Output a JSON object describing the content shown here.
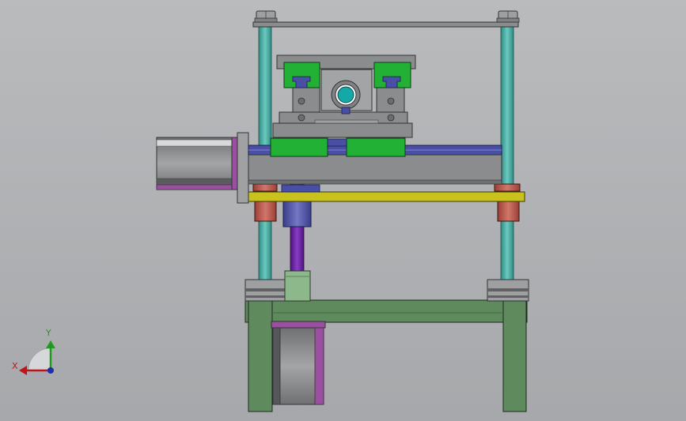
{
  "viewport": {
    "background": "#afb1b4",
    "model": "cad-linear-stage-assembly"
  },
  "triad": {
    "x_label": "X",
    "y_label": "Y",
    "x_color": "#c0141a",
    "y_color": "#1e9b1e",
    "z_color": "#1f2fa8"
  },
  "colors": {
    "frame_green": "#5e8a5d",
    "rail_green": "#22b134",
    "rod_teal": "#3e9e95",
    "screw_purple": "#6a1ea0",
    "motor_gray": "#8a8c8e",
    "plate_yellow": "#c9c21c",
    "bushing_red": "#b85549",
    "bearing_cyan": "#15a8a8",
    "slot_blue": "#4a4fa6",
    "flange_magenta": "#9b4fa0"
  }
}
